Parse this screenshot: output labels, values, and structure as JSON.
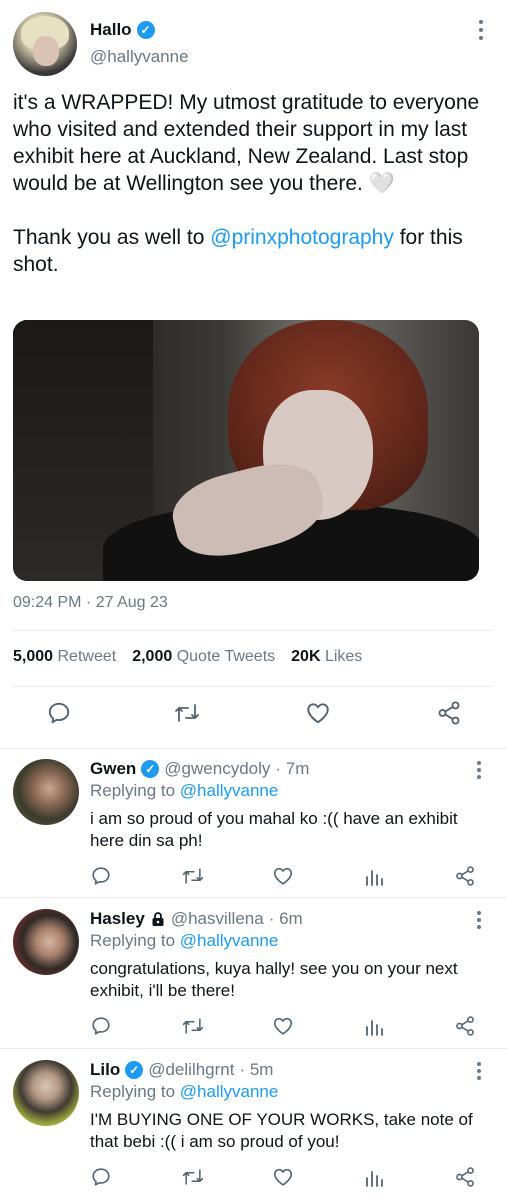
{
  "main_tweet": {
    "name": "Hallo",
    "handle": "@hallyvanne",
    "text_before_link": "it's a WRAPPED! My utmost gratitude to everyone who visited and extended their support in my last exhibit here at Auckland, New Zealand. Last stop would be at Wellington see you there. 🤍\n\nThank you as well to ",
    "mention": "@prinxphotography",
    "text_after_link": " for this shot.",
    "timestamp": "09:24 PM · 27 Aug 23",
    "retweets_count": "5,000",
    "retweets_label": "Retweet",
    "quotes_count": "2,000",
    "quotes_label": "Quote Tweets",
    "likes_count": "20K",
    "likes_label": "Likes",
    "icons": [
      "more-icon",
      "reply-icon",
      "retweet-icon",
      "like-icon",
      "share-icon"
    ]
  },
  "replying_label": "Replying to",
  "replies": [
    {
      "name": "Gwen",
      "verified": true,
      "handle": "@gwencydoly",
      "time": "· 7m",
      "replying_to": "@hallyvanne",
      "text": "i am so proud of you mahal ko :(( have an exhibit here din sa ph!"
    },
    {
      "name": "Hasley",
      "protected": true,
      "handle": "@hasvillena",
      "time": "· 6m",
      "replying_to": "@hallyvanne",
      "text": "congratulations, kuya hally! see you on your next exhibit, i'll be there!"
    },
    {
      "name": "Lilo",
      "verified": true,
      "handle": "@delilhgrnt",
      "time": "· 5m",
      "replying_to": "@hallyvanne",
      "text": "I'M BUYING ONE OF YOUR WORKS, take note of that bebi :(( i am so proud of you!"
    }
  ],
  "colors": {
    "accent": "#1d9bf0",
    "muted": "#6b7885",
    "text": "#0f1419",
    "divider": "#e6ecf0"
  }
}
